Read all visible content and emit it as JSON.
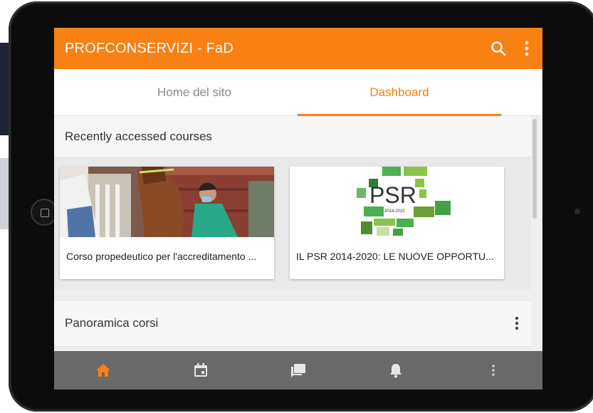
{
  "appbar": {
    "title": "PROFCONSERVIZI - FaD",
    "search_icon": "search-icon",
    "menu_icon": "more-vert-icon",
    "color": "#f98012"
  },
  "tabs": [
    {
      "label": "Home del sito",
      "active": false
    },
    {
      "label": "Dashboard",
      "active": true
    }
  ],
  "recent": {
    "title": "Recently accessed courses",
    "courses": [
      {
        "name": "Corso propedeutico per l'accreditamento ...",
        "image": "horse-vet-photo"
      },
      {
        "name": "IL PSR 2014-2020: LE NUOVE OPPORTU...",
        "image": "psr-logo",
        "logo_text": "PSR",
        "logo_sub": "2014-2020"
      }
    ]
  },
  "overview": {
    "title": "Panoramica corsi",
    "menu_icon": "more-vert-icon"
  },
  "bottom_nav": [
    {
      "icon": "home-icon",
      "active": true
    },
    {
      "icon": "calendar-icon",
      "active": false
    },
    {
      "icon": "messages-icon",
      "active": false
    },
    {
      "icon": "bell-icon",
      "active": false
    },
    {
      "icon": "more-vert-icon",
      "active": false
    }
  ],
  "colors": {
    "accent": "#f98012",
    "bottom_bar": "#696969"
  }
}
